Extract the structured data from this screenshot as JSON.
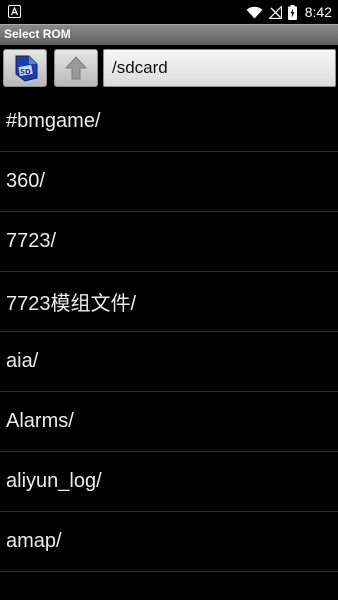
{
  "status_bar": {
    "time": "8:42",
    "icons": [
      "app-a-icon",
      "wifi-icon",
      "no-signal-icon",
      "battery-charging-icon"
    ]
  },
  "title_bar": {
    "title": "Select ROM"
  },
  "toolbar": {
    "device_button_icon": "storage-device-icon",
    "up_button_icon": "up-arrow-icon",
    "path": "/sdcard"
  },
  "file_list": {
    "items": [
      "#bmgame/",
      "360/",
      "7723/",
      "7723模组文件/",
      "aia/",
      "Alarms/",
      "aliyun_log/",
      "amap/"
    ]
  },
  "colors": {
    "background": "#000000",
    "title_bar": "#7a7a7a",
    "text": "#ececec",
    "divider": "#2a2a2a"
  }
}
